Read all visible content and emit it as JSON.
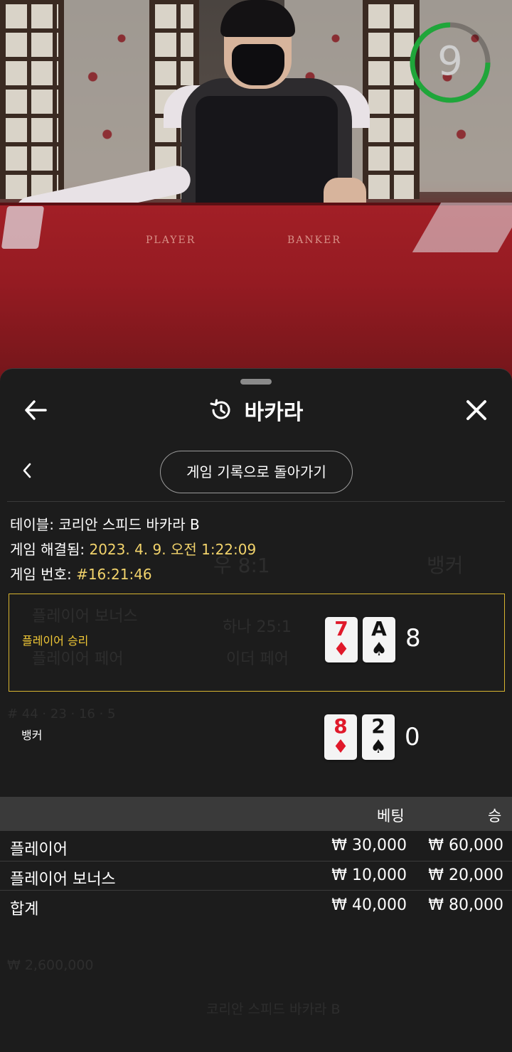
{
  "video": {
    "table_labels": [
      "PLAYER",
      "BANKER"
    ],
    "countdown": "9",
    "countdown_fraction": 0.75
  },
  "header": {
    "title": "바카라",
    "back_icon": "arrow-left-icon",
    "history_icon": "history-icon",
    "close_icon": "close-icon"
  },
  "subnav": {
    "back_icon": "chevron-left-icon",
    "return_button_label": "게임 기록으로 돌아가기"
  },
  "game_info": {
    "table_label": "테이블:",
    "table_value": "코리안 스피드 바카라 B",
    "resolved_label": "게임 해결됨:",
    "resolved_value": "2023. 4. 9. 오전 1:22:09",
    "number_label": "게임 번호:",
    "number_value": "#16:21:46"
  },
  "hands": {
    "player": {
      "label": "플레이어 승리",
      "cards": [
        {
          "rank": "7",
          "suit": "♦",
          "color": "red"
        },
        {
          "rank": "A",
          "suit": "♠",
          "color": "black"
        }
      ],
      "score": "8"
    },
    "banker": {
      "label": "뱅커",
      "cards": [
        {
          "rank": "8",
          "suit": "♦",
          "color": "red"
        },
        {
          "rank": "2",
          "suit": "♠",
          "color": "black"
        }
      ],
      "score": "0"
    }
  },
  "bets": {
    "col_bet": "베팅",
    "col_win": "승",
    "rows": [
      {
        "label": "플레이어",
        "bet": "₩ 30,000",
        "win": "₩ 60,000"
      },
      {
        "label": "플레이어 보너스",
        "bet": "₩ 10,000",
        "win": "₩ 20,000"
      }
    ],
    "total": {
      "label": "합계",
      "bet": "₩ 40,000",
      "win": "₩ 80,000"
    }
  },
  "colors": {
    "accent_gold": "#f2c936",
    "timer_green": "#1fa63a",
    "card_red": "#e0192a"
  }
}
